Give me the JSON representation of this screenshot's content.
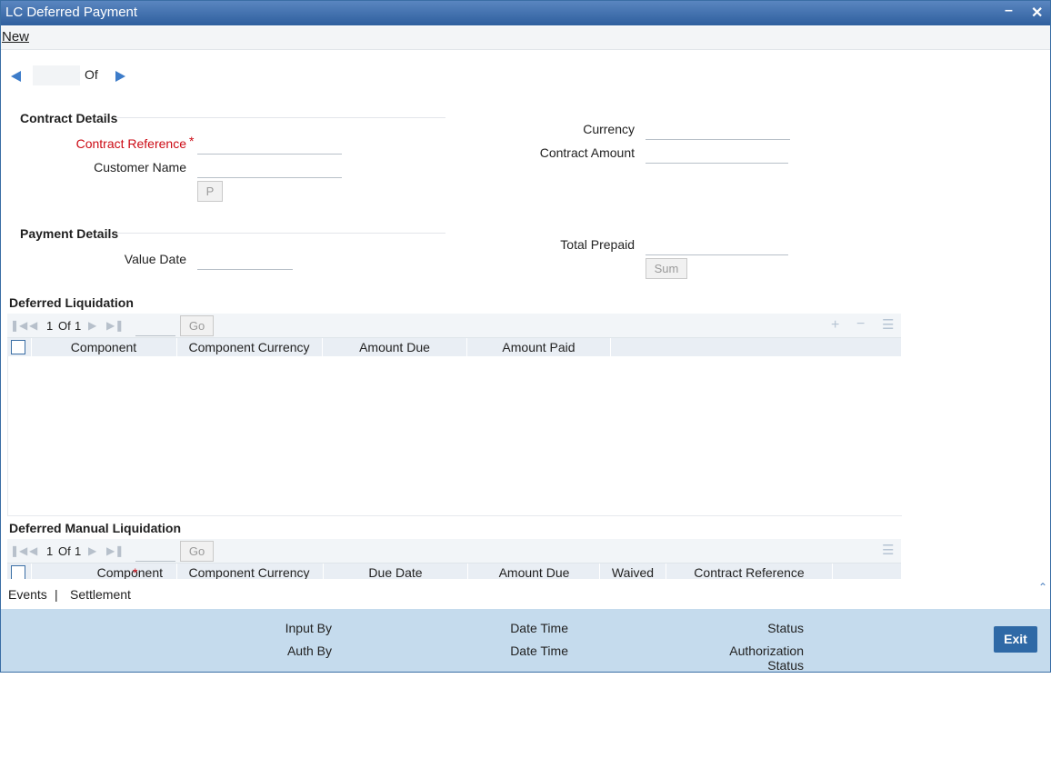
{
  "window": {
    "title": "LC Deferred Payment"
  },
  "menu": {
    "new_label": "New"
  },
  "record_nav": {
    "of_label": "Of"
  },
  "contract_details": {
    "section_title": "Contract Details",
    "contract_reference_label": "Contract Reference",
    "required_mark": "*",
    "customer_name_label": "Customer Name",
    "p_button_label": "P",
    "currency_label": "Currency",
    "contract_amount_label": "Contract Amount"
  },
  "payment_details": {
    "section_title": "Payment Details",
    "value_date_label": "Value Date",
    "total_prepaid_label": "Total Prepaid",
    "sum_button_label": "Sum"
  },
  "deferred_liquidation": {
    "section_title": "Deferred Liquidation",
    "page_current": "1",
    "page_of": "Of",
    "page_total": "1",
    "go_label": "Go",
    "columns": [
      "Component",
      "Component Currency",
      "Amount Due",
      "Amount Paid"
    ]
  },
  "deferred_manual_liquidation": {
    "section_title": "Deferred Manual Liquidation",
    "page_current": "1",
    "page_of": "Of",
    "page_total": "1",
    "go_label": "Go",
    "columns": [
      "Component",
      "Component Currency",
      "Due Date",
      "Amount Due",
      "Waived",
      "Contract Reference"
    ],
    "required_mark": "*"
  },
  "bottom_tabs": {
    "events": "Events",
    "separator": "|",
    "settlement": "Settlement"
  },
  "audit": {
    "input_by": "Input By",
    "date_time_1": "Date Time",
    "status": "Status",
    "auth_by": "Auth By",
    "date_time_2": "Date Time",
    "authorization_status_line1": "Authorization",
    "authorization_status_line2": "Status",
    "exit_label": "Exit"
  },
  "colors": {
    "titlebar": "#2f5f9e",
    "accent": "#2f69a6",
    "required": "#cc0a14",
    "audit_bg": "#c5dbed"
  }
}
